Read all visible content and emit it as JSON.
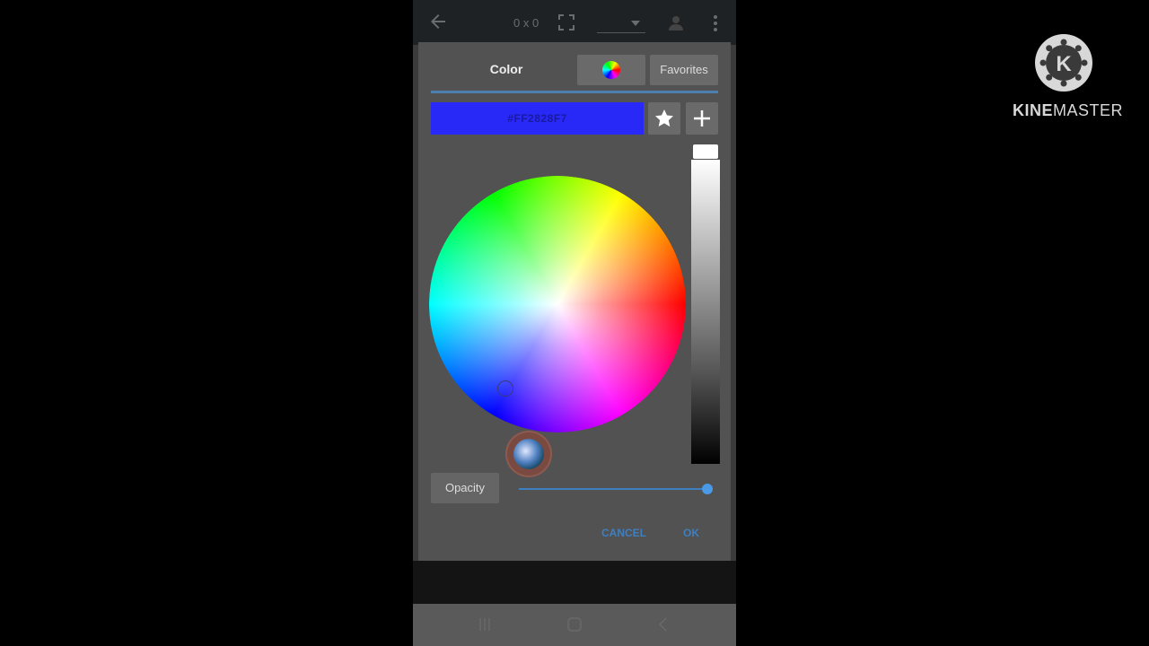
{
  "topbar": {
    "size_label": "0 x 0",
    "icons": [
      "back-arrow-icon",
      "fullscreen-icon",
      "dropdown-arrow-icon",
      "person-icon",
      "more-vert-icon"
    ]
  },
  "color_dialog": {
    "tabs": {
      "color_label": "Color",
      "wheel_icon": "color-wheel-icon",
      "favorites_label": "Favorites"
    },
    "hex_value": "#FF2828F7",
    "hex_swatch_color": "#2828f7",
    "star_icon": "star-icon",
    "add_icon": "plus-icon",
    "opacity_label": "Opacity",
    "opacity_value": 1.0,
    "cancel_label": "CANCEL",
    "ok_label": "OK",
    "accent_color": "#3f7fc0"
  },
  "navbar": {
    "icons": [
      "recent-apps-icon",
      "home-icon",
      "back-icon"
    ]
  },
  "watermark": {
    "brand_bold": "KINE",
    "brand_regular": "MASTER",
    "logo_letter": "K"
  }
}
